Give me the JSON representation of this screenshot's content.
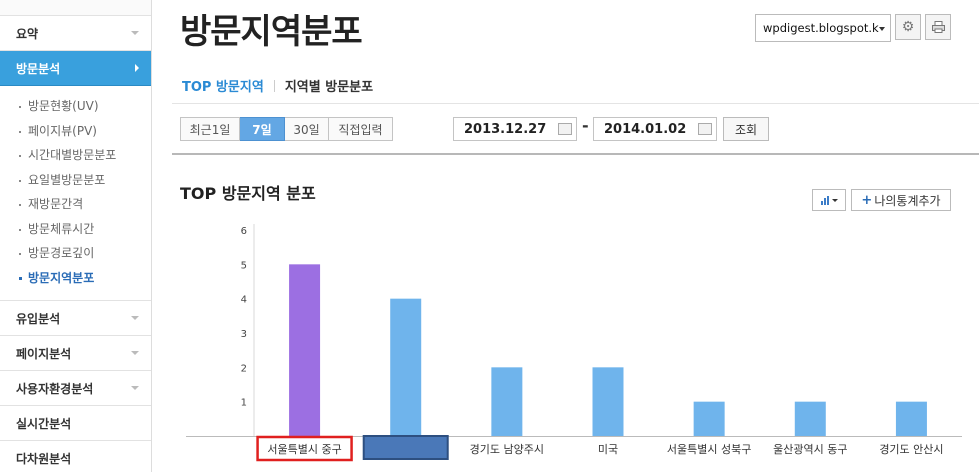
{
  "sidebar": {
    "sections_top": [
      {
        "label": "요약",
        "active": false
      },
      {
        "label": "방문분석",
        "active": true
      }
    ],
    "sub_items": [
      {
        "label": "방문현황(UV)",
        "current": false
      },
      {
        "label": "페이지뷰(PV)",
        "current": false
      },
      {
        "label": "시간대별방문분포",
        "current": false
      },
      {
        "label": "요일별방문분포",
        "current": false
      },
      {
        "label": "재방문간격",
        "current": false
      },
      {
        "label": "방문체류시간",
        "current": false
      },
      {
        "label": "방문경로깊이",
        "current": false
      },
      {
        "label": "방문지역분포",
        "current": true
      }
    ],
    "sections_bottom": [
      {
        "label": "유입분석",
        "chevron": true
      },
      {
        "label": "페이지분석",
        "chevron": true
      },
      {
        "label": "사용자환경분석",
        "chevron": true
      },
      {
        "label": "실시간분석",
        "chevron": false
      },
      {
        "label": "다차원분석",
        "chevron": false
      }
    ]
  },
  "header": {
    "title": "방문지역분포",
    "site_select": "wpdigest.blogspot.k",
    "settings_icon": "gear-icon",
    "print_icon": "printer-icon"
  },
  "tabs": {
    "active": "TOP 방문지역",
    "other": "지역별 방문분포"
  },
  "filters": {
    "periods": [
      {
        "label": "최근1일",
        "on": false
      },
      {
        "label": "7일",
        "on": true
      },
      {
        "label": "30일",
        "on": false
      },
      {
        "label": "직접입력",
        "on": false
      }
    ],
    "date_from": "2013.12.27",
    "date_to": "2014.01.02",
    "dash": "-",
    "search_label": "조회"
  },
  "chart_section": {
    "title": "TOP 방문지역 분포",
    "chart_type_icon": "bar-chart-icon",
    "add_label": "나의통계추가"
  },
  "colors": {
    "highlight_bar": "#9c6fe2",
    "bar": "#6fb4ec",
    "active_blue": "#39a0dd",
    "redact_box": "#4a78b8",
    "highlight_outline": "#e0201f"
  },
  "chart_data": {
    "type": "bar",
    "categories": [
      "서울특별시 중구",
      "",
      "경기도 남양주시",
      "미국",
      "서울특별시 성북구",
      "울산광역시 동구",
      "경기도 안산시"
    ],
    "values": [
      5,
      4,
      2,
      2,
      1,
      1,
      1
    ],
    "highlight_index": 0,
    "redacted_index": 1,
    "title": "TOP 방문지역 분포",
    "xlabel": "",
    "ylabel": "",
    "ylim": [
      0,
      6
    ],
    "yticks": [
      1,
      2,
      3,
      4,
      5,
      6
    ],
    "grid": false
  }
}
